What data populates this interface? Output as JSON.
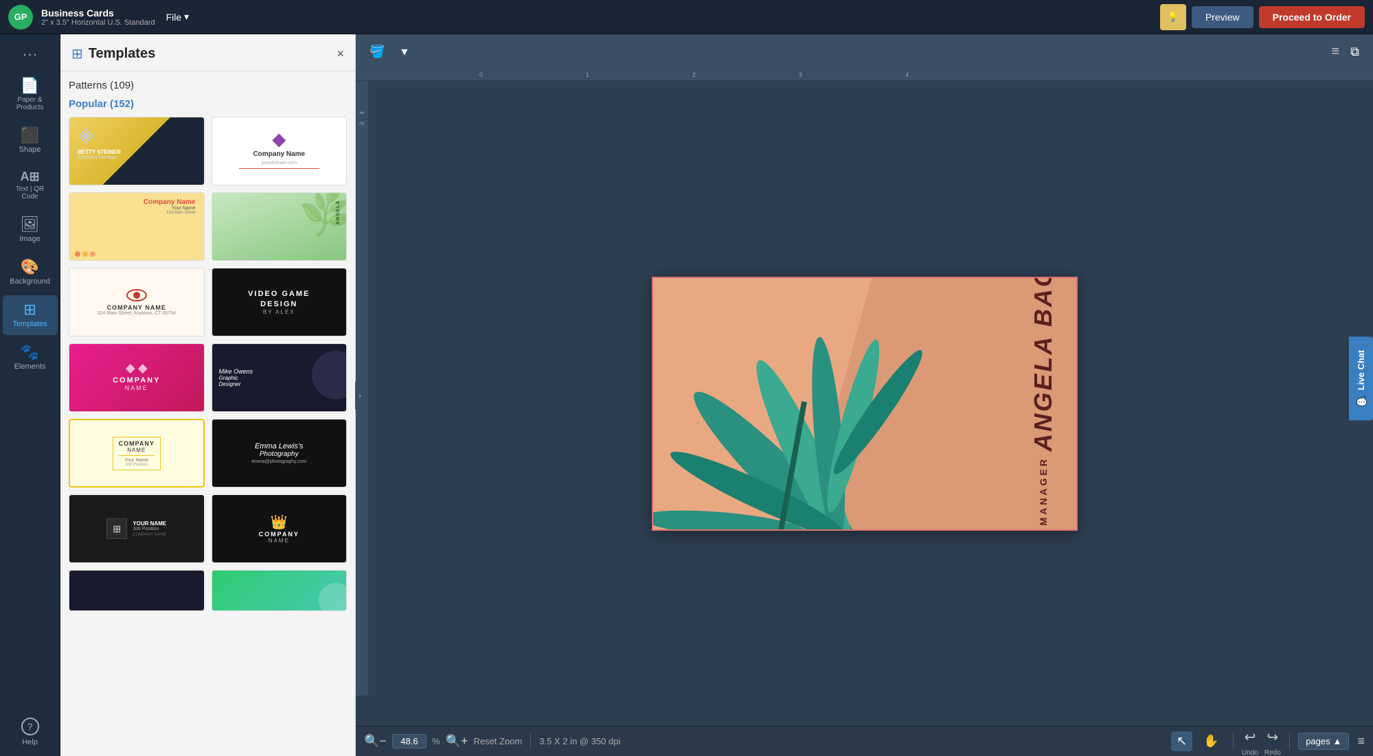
{
  "app": {
    "logo": "GP",
    "title": "Business Cards",
    "subtitle": "2\" x 3.5\" Horizontal U.S. Standard",
    "file_menu": "File"
  },
  "topbar": {
    "preview_label": "Preview",
    "order_label": "Proceed to Order"
  },
  "left_nav": {
    "items": [
      {
        "id": "more",
        "icon": "···",
        "label": ""
      },
      {
        "id": "paper-products",
        "icon": "📄",
        "label": "Paper &\nProducts"
      },
      {
        "id": "shape",
        "icon": "⬛",
        "label": "Shape"
      },
      {
        "id": "text-qr",
        "icon": "A",
        "label": "Text | QR\nCode"
      },
      {
        "id": "image",
        "icon": "🖼",
        "label": "Image"
      },
      {
        "id": "background",
        "icon": "🎨",
        "label": "Background"
      },
      {
        "id": "templates",
        "icon": "⊞",
        "label": "Templates"
      },
      {
        "id": "elements",
        "icon": "🐾",
        "label": "Elements"
      },
      {
        "id": "help",
        "icon": "?",
        "label": "Help"
      }
    ]
  },
  "templates_panel": {
    "title": "Templates",
    "close_label": "×",
    "patterns_label": "Patterns (109)",
    "popular_label": "Popular (152)",
    "templates": [
      {
        "id": 1,
        "style": "gold-dark",
        "name": "BETTY STEINER",
        "sub": "Assistant Manager"
      },
      {
        "id": 2,
        "style": "white-diamond",
        "name": "Company Name",
        "sub": "yourdomain.com"
      },
      {
        "id": 3,
        "style": "yellow-dots",
        "name": "Company Name",
        "sub": ""
      },
      {
        "id": 4,
        "style": "green-palm",
        "name": "",
        "sub": ""
      },
      {
        "id": 5,
        "style": "white-eye",
        "name": "COMPANY NAME",
        "sub": ""
      },
      {
        "id": 6,
        "style": "video-game",
        "name": "VIDEO GAME DESIGN",
        "sub": "BY ALEX"
      },
      {
        "id": 7,
        "style": "pink-gradient",
        "name": "COMPANY NAME",
        "sub": ""
      },
      {
        "id": 8,
        "style": "dark-circle",
        "name": "Mike Owens Graphic Designer",
        "sub": ""
      },
      {
        "id": 9,
        "style": "yellow-border",
        "name": "COMPANY NAME",
        "sub": "Your Name"
      },
      {
        "id": 10,
        "style": "dark-script",
        "name": "Emma Lewis Photography",
        "sub": ""
      },
      {
        "id": 11,
        "style": "dark-grid",
        "name": "YOUR NAME",
        "sub": "COMPANY NAME"
      },
      {
        "id": 12,
        "style": "dark-crown",
        "name": "COMPANY NAME",
        "sub": ""
      },
      {
        "id": 13,
        "style": "very-dark",
        "name": "",
        "sub": ""
      },
      {
        "id": 14,
        "style": "teal-dots",
        "name": "",
        "sub": ""
      }
    ]
  },
  "canvas": {
    "card": {
      "name": "ANGELA BAGLEY",
      "title": "PROJECT MANAGER",
      "bg_color": "#e8a882"
    }
  },
  "status_bar": {
    "zoom_value": "48.6",
    "zoom_unit": "%",
    "reset_zoom_label": "Reset Zoom",
    "dimensions": "3.5 X 2 in @ 350 dpi",
    "undo_label": "Undo",
    "redo_label": "Redo",
    "pages_label": "pages"
  }
}
